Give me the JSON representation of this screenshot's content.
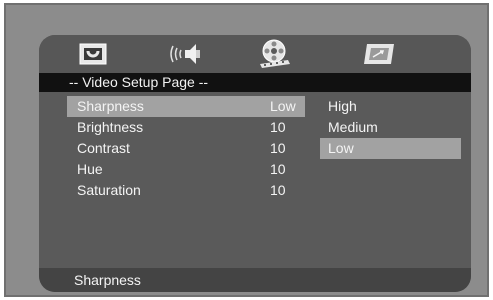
{
  "tabs": [
    {
      "icon": "picture-icon"
    },
    {
      "icon": "speaker-icon"
    },
    {
      "icon": "video-reel-icon"
    },
    {
      "icon": "preferences-icon"
    }
  ],
  "page_title": "-- Video Setup Page --",
  "menu": [
    {
      "label": "Sharpness",
      "value": "Low"
    },
    {
      "label": "Brightness",
      "value": "10"
    },
    {
      "label": "Contrast",
      "value": "10"
    },
    {
      "label": "Hue",
      "value": "10"
    },
    {
      "label": "Saturation",
      "value": "10"
    }
  ],
  "options": [
    "High",
    "Medium",
    "Low"
  ],
  "status": "Sharpness",
  "colors": {
    "highlight": "#a2a2a2",
    "title_bar": "#111111",
    "panel": "#5a5a5a"
  }
}
